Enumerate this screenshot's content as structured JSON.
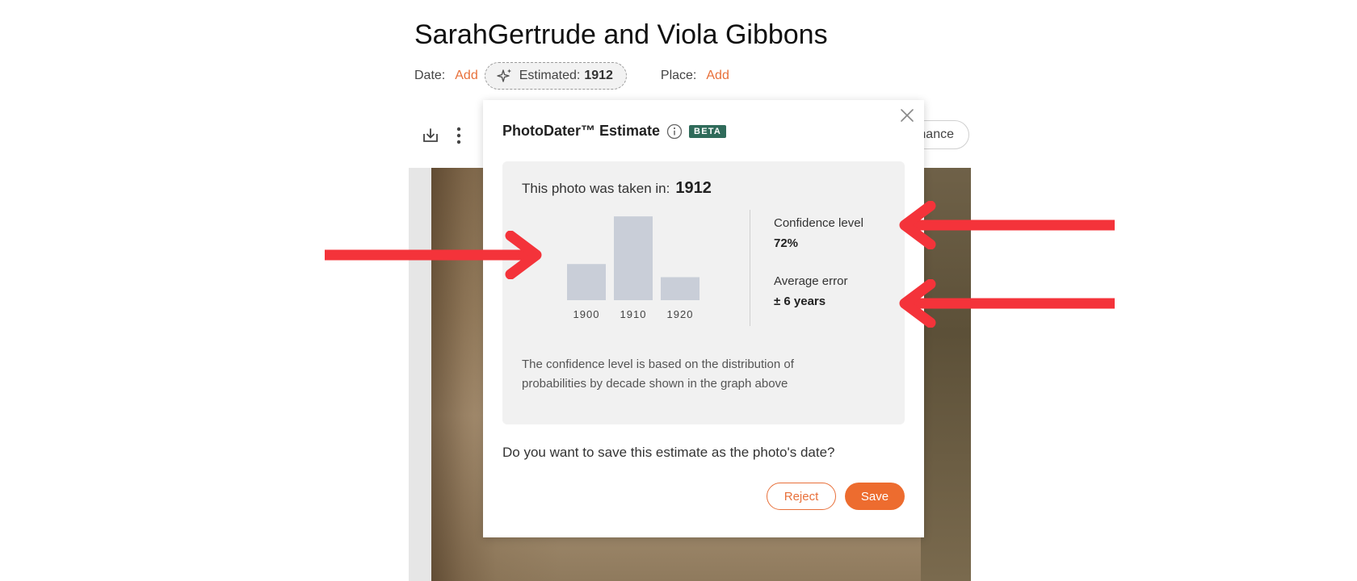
{
  "page": {
    "title": "SarahGertrude and Viola Gibbons"
  },
  "meta": {
    "date_label": "Date:",
    "date_add": "Add",
    "estimated_prefix": "Estimated:",
    "estimated_year": "1912",
    "place_label": "Place:",
    "place_add": "Add"
  },
  "toolbar": {
    "download_icon": "download-icon",
    "more_icon": "more-vertical-icon",
    "enhance_label": "hance"
  },
  "popup": {
    "title": "PhotoDater™ Estimate",
    "beta_badge": "BETA",
    "taken_label": "This photo was taken in:",
    "taken_year": "1912",
    "confidence_label": "Confidence level",
    "confidence_value": "72%",
    "error_label": "Average error",
    "error_value": "± 6 years",
    "note": "The confidence level is based on the distribution of probabilities by decade shown in the graph above",
    "question": "Do you want to save this estimate as the photo's date?",
    "reject_label": "Reject",
    "save_label": "Save"
  },
  "chart_data": {
    "type": "bar",
    "categories": [
      "1900",
      "1910",
      "1920"
    ],
    "values": [
      0.22,
      0.51,
      0.14
    ],
    "title": "",
    "xlabel": "",
    "ylabel": "",
    "ylim": [
      0,
      0.55
    ],
    "bar_color": "#c9ced8"
  },
  "colors": {
    "accent": "#e8703a",
    "beta": "#2f6b5a",
    "annotation_arrow": "#f4333a"
  },
  "annotations": {
    "arrow_icon": "red-arrow-icon"
  }
}
